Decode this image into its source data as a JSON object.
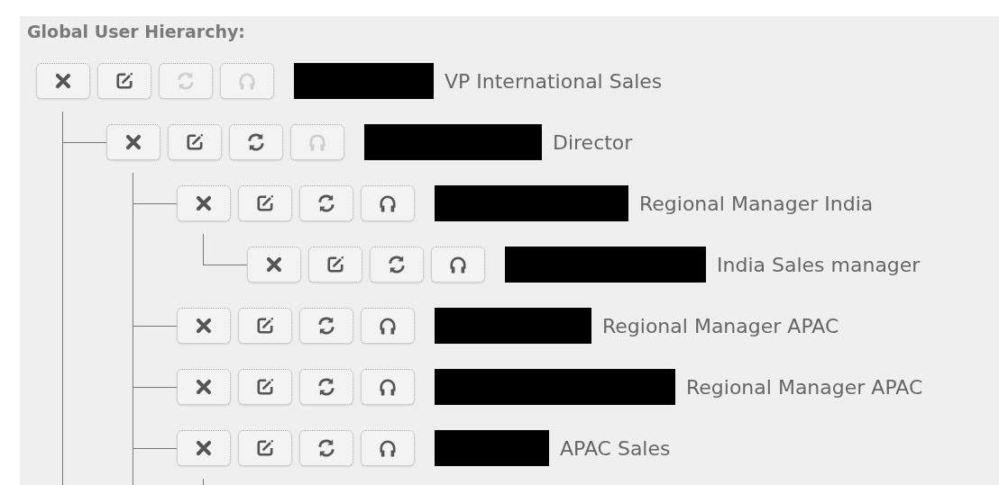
{
  "heading": "Global User Hierarchy:",
  "tree": [
    {
      "label": "VP International Sales",
      "continued": true,
      "actions": [
        {
          "kind": "delete",
          "disabled": false
        },
        {
          "kind": "edit",
          "disabled": false
        },
        {
          "kind": "refresh",
          "disabled": true
        },
        {
          "kind": "headset",
          "disabled": true
        }
      ],
      "children": [
        {
          "label": "Director",
          "continued": true,
          "actions": [
            {
              "kind": "delete",
              "disabled": false
            },
            {
              "kind": "edit",
              "disabled": false
            },
            {
              "kind": "refresh",
              "disabled": false
            },
            {
              "kind": "headset",
              "disabled": true
            }
          ],
          "children": [
            {
              "label": "Regional Manager India",
              "continued": false,
              "actions": [
                {
                  "kind": "delete",
                  "disabled": false
                },
                {
                  "kind": "edit",
                  "disabled": false
                },
                {
                  "kind": "refresh",
                  "disabled": false
                },
                {
                  "kind": "headset",
                  "disabled": false
                }
              ],
              "children": [
                {
                  "label": "India Sales manager",
                  "continued": false,
                  "actions": [
                    {
                      "kind": "delete",
                      "disabled": false
                    },
                    {
                      "kind": "edit",
                      "disabled": false
                    },
                    {
                      "kind": "refresh",
                      "disabled": false
                    },
                    {
                      "kind": "headset",
                      "disabled": false
                    }
                  ]
                }
              ]
            },
            {
              "label": "Regional Manager APAC",
              "continued": false,
              "actions": [
                {
                  "kind": "delete",
                  "disabled": false
                },
                {
                  "kind": "edit",
                  "disabled": false
                },
                {
                  "kind": "refresh",
                  "disabled": false
                },
                {
                  "kind": "headset",
                  "disabled": false
                }
              ]
            },
            {
              "label": "Regional Manager APAC",
              "continued": false,
              "actions": [
                {
                  "kind": "delete",
                  "disabled": false
                },
                {
                  "kind": "edit",
                  "disabled": false
                },
                {
                  "kind": "refresh",
                  "disabled": false
                },
                {
                  "kind": "headset",
                  "disabled": false
                }
              ]
            },
            {
              "label": "APAC Sales",
              "continued": true,
              "actions": [
                {
                  "kind": "delete",
                  "disabled": false
                },
                {
                  "kind": "edit",
                  "disabled": false
                },
                {
                  "kind": "refresh",
                  "disabled": false
                },
                {
                  "kind": "headset",
                  "disabled": false
                }
              ]
            }
          ]
        }
      ]
    }
  ]
}
